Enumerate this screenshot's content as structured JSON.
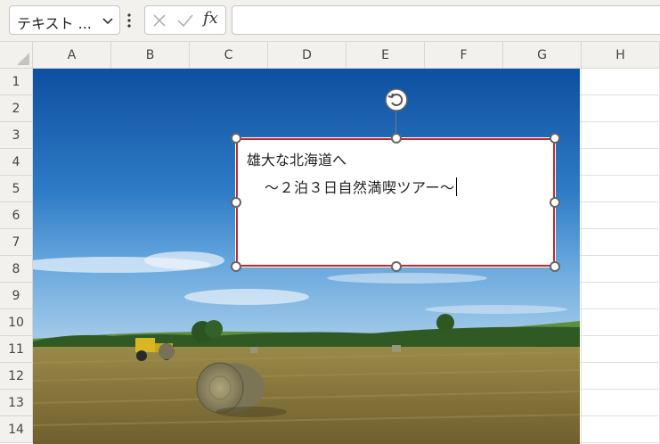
{
  "formula_bar": {
    "name_box_value": "テキスト ...",
    "cancel_icon": "x-icon",
    "enter_icon": "check-icon",
    "function_label": "fx",
    "formula_value": ""
  },
  "grid": {
    "columns": [
      "A",
      "B",
      "C",
      "D",
      "E",
      "F",
      "G",
      "H"
    ],
    "rows": [
      "1",
      "2",
      "3",
      "4",
      "5",
      "6",
      "7",
      "8",
      "9",
      "10",
      "11",
      "12",
      "13",
      "14"
    ]
  },
  "picture": {
    "description_icon": "landscape-photo",
    "sky_color": "#2a6fb8",
    "field_color": "#8a7a3c"
  },
  "textbox": {
    "line1": "雄大な北海道へ",
    "line2": "〜２泊３日自然満喫ツアー〜",
    "border_color": "#c62828"
  }
}
